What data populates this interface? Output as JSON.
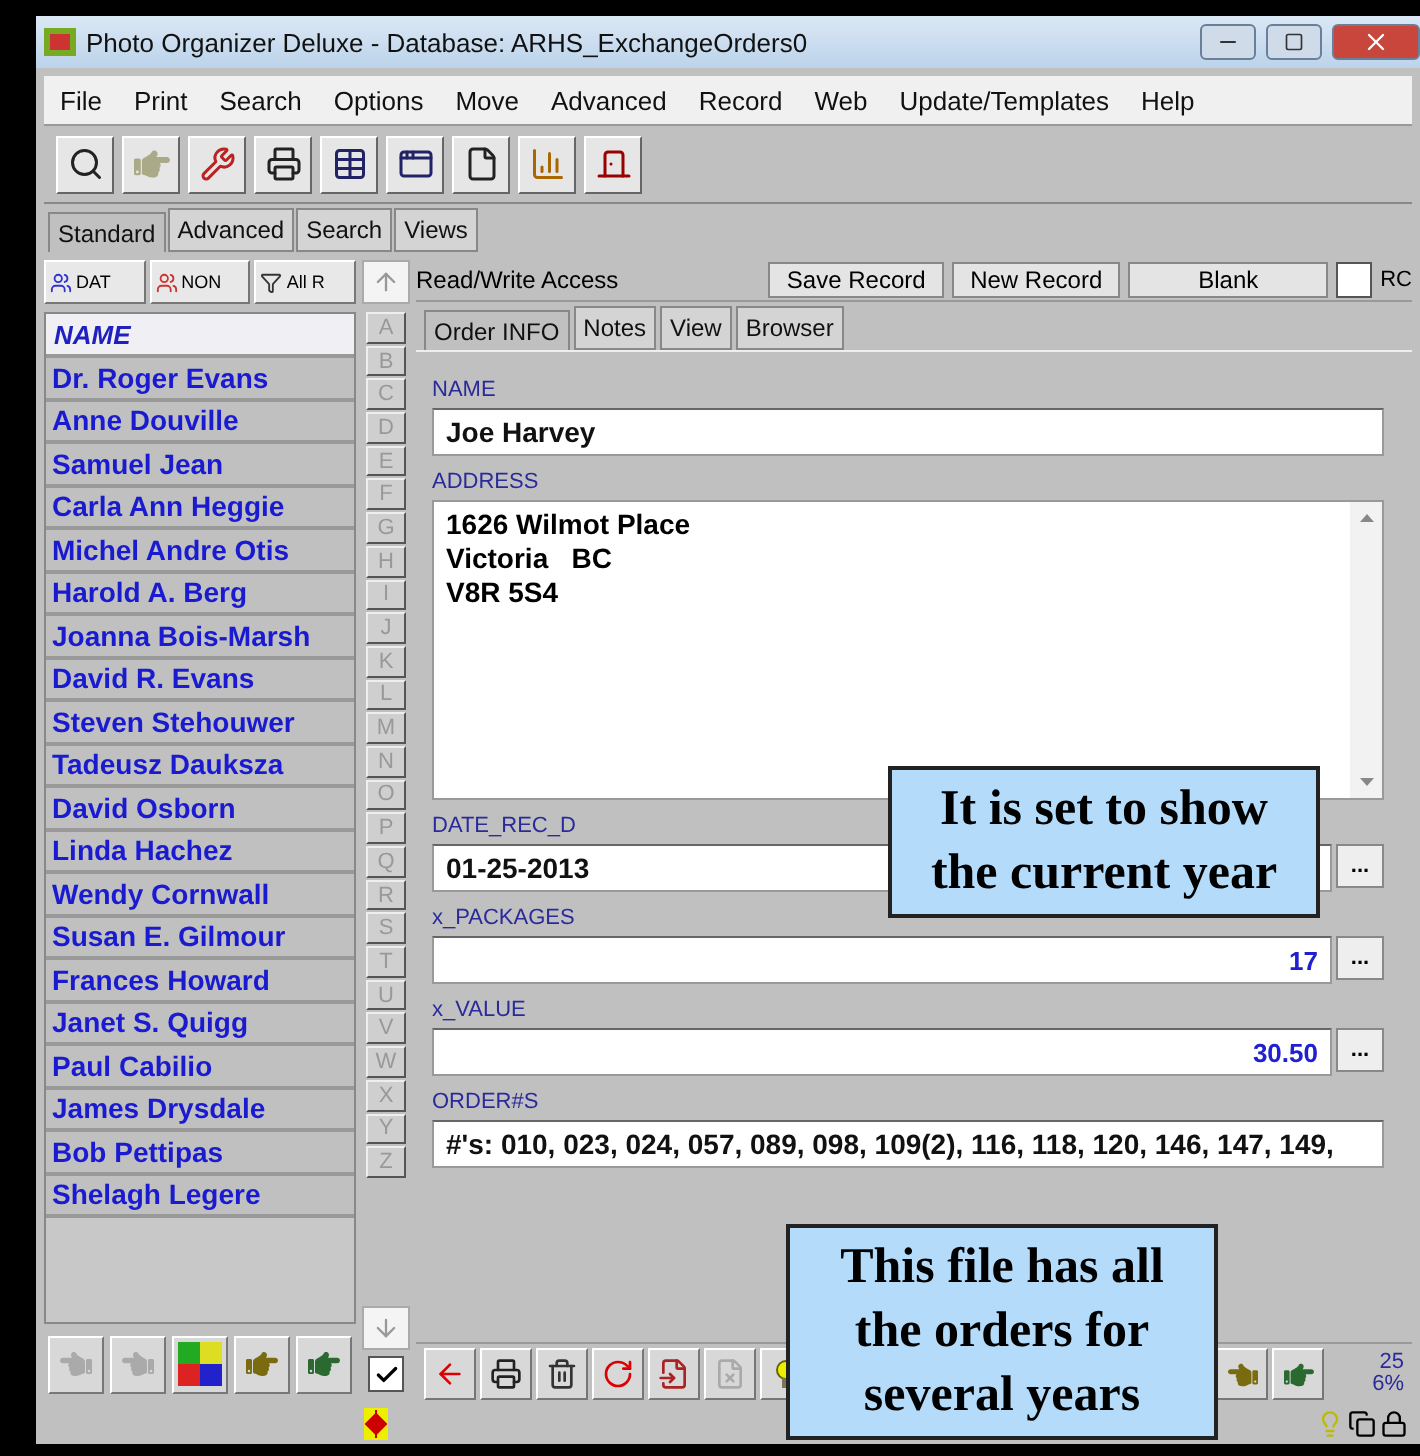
{
  "window": {
    "title": "Photo Organizer Deluxe - Database: ARHS_ExchangeOrders0"
  },
  "menu": [
    "File",
    "Print",
    "Search",
    "Options",
    "Move",
    "Advanced",
    "Record",
    "Web",
    "Update/Templates",
    "Help"
  ],
  "tabs": [
    {
      "label": "Standard",
      "selected": true
    },
    {
      "label": "Advanced",
      "selected": false
    },
    {
      "label": "Search",
      "selected": false
    },
    {
      "label": "Views",
      "selected": false
    }
  ],
  "left_panel": {
    "filter_buttons": [
      "DAT",
      "NON",
      "All R"
    ],
    "list_header": "NAME",
    "names": [
      "Dr. Roger Evans",
      "Anne Douville",
      "Samuel Jean",
      "Carla Ann Heggie",
      "Michel Andre Otis",
      "Harold A. Berg",
      "Joanna Bois-Marsh",
      "David R. Evans",
      "Steven Stehouwer",
      "Tadeusz Dauksza",
      "David Osborn",
      "Linda Hachez",
      "Wendy Cornwall",
      "Susan E. Gilmour",
      "Frances Howard",
      "Janet S. Quigg",
      "Paul Cabilio",
      "James Drysdale",
      "Bob Pettipas",
      "Shelagh Legere"
    ]
  },
  "alphabet": [
    "A",
    "B",
    "C",
    "D",
    "E",
    "F",
    "G",
    "H",
    "I",
    "J",
    "K",
    "L",
    "M",
    "N",
    "O",
    "P",
    "Q",
    "R",
    "S",
    "T",
    "U",
    "V",
    "W",
    "X",
    "Y",
    "Z"
  ],
  "alphabet_checkbox": {
    "checked": true
  },
  "record_bar": {
    "access": "Read/Write Access",
    "buttons": [
      "Save Record",
      "New Record",
      "Blank"
    ],
    "checkbox": {
      "checked": false
    },
    "cut_label": "RC"
  },
  "record_tabs": [
    {
      "label": "Order INFO",
      "selected": true
    },
    {
      "label": "Notes",
      "selected": false
    },
    {
      "label": "View",
      "selected": false
    },
    {
      "label": "Browser",
      "selected": false
    }
  ],
  "fields": [
    {
      "label": "NAME",
      "kind": "text",
      "value": "Joe Harvey"
    },
    {
      "label": "ADDRESS",
      "kind": "textarea",
      "value": "1626 Wilmot Place\nVictoria   BC\nV8R 5S4"
    },
    {
      "label": "DATE_REC_D",
      "kind": "picker",
      "value": "01-25-2013",
      "button": "..."
    },
    {
      "label": "x_PACKAGES",
      "kind": "number",
      "value": "17",
      "button": "..."
    },
    {
      "label": "x_VALUE",
      "kind": "number",
      "value": "30.50",
      "button": "..."
    },
    {
      "label": "ORDER#S",
      "kind": "text",
      "value": "#'s: 010, 023, 024, 057, 089, 098, 109(2), 116, 118, 120, 146, 147, 149,"
    }
  ],
  "counter": [
    "25",
    "6%"
  ],
  "callouts": [
    {
      "text": "It is set to show\nthe current year"
    },
    {
      "text": "This file has all\nthe orders for\nseveral years"
    }
  ]
}
